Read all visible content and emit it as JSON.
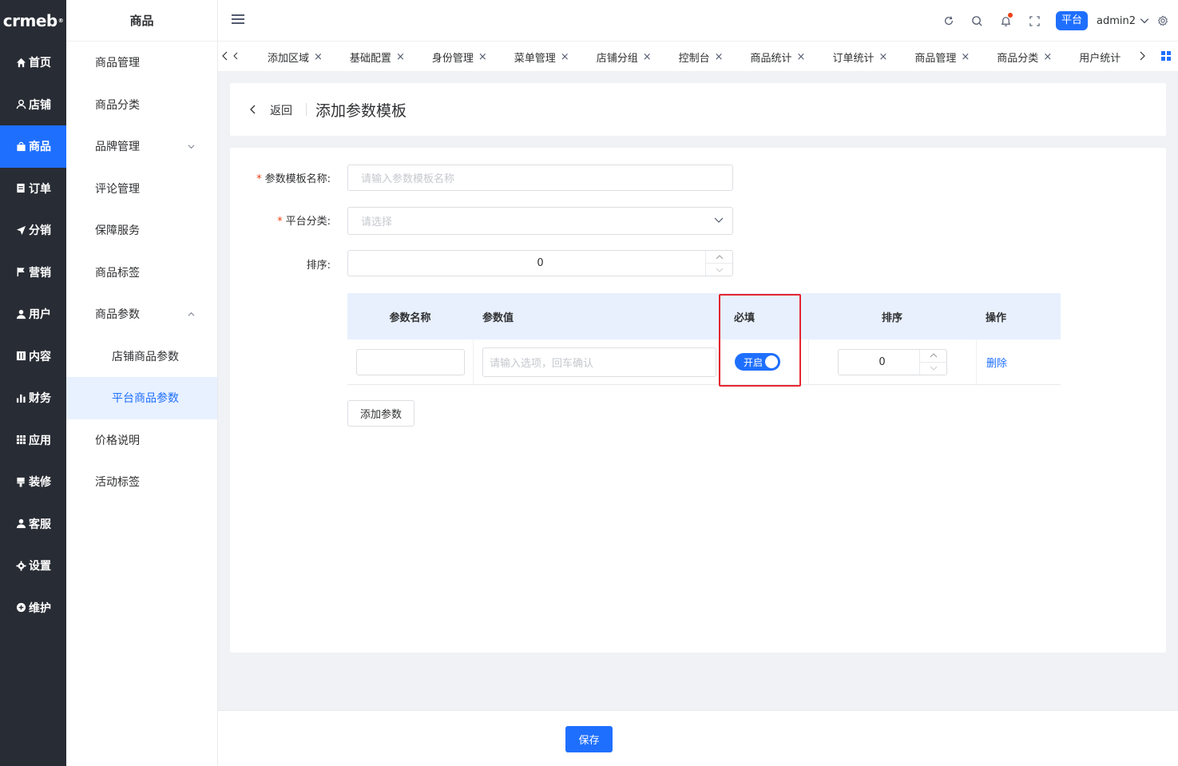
{
  "brand": {
    "name": "crmeb",
    "mark": "®"
  },
  "nav": {
    "items": [
      {
        "label": "首页",
        "icon": "home-icon"
      },
      {
        "label": "店铺",
        "icon": "shop-icon"
      },
      {
        "label": "商品",
        "icon": "goods-icon"
      },
      {
        "label": "订单",
        "icon": "order-icon"
      },
      {
        "label": "分销",
        "icon": "send-icon"
      },
      {
        "label": "营销",
        "icon": "flag-icon"
      },
      {
        "label": "用户",
        "icon": "user-icon"
      },
      {
        "label": "内容",
        "icon": "content-icon"
      },
      {
        "label": "财务",
        "icon": "bar-chart-icon"
      },
      {
        "label": "应用",
        "icon": "grid-icon"
      },
      {
        "label": "装修",
        "icon": "brush-icon"
      },
      {
        "label": "客服",
        "icon": "service-icon"
      },
      {
        "label": "设置",
        "icon": "gear-icon"
      },
      {
        "label": "维护",
        "icon": "plus-circle-icon"
      }
    ],
    "active_index": 2
  },
  "submenu": {
    "title": "商品",
    "items": [
      {
        "label": "商品管理"
      },
      {
        "label": "商品分类"
      },
      {
        "label": "品牌管理"
      },
      {
        "label": "评论管理"
      },
      {
        "label": "保障服务"
      },
      {
        "label": "商品标签"
      },
      {
        "label": "商品参数"
      },
      {
        "label": "店铺商品参数"
      },
      {
        "label": "平台商品参数"
      },
      {
        "label": "价格说明"
      },
      {
        "label": "活动标签"
      }
    ]
  },
  "header": {
    "icons": [
      "refresh-icon",
      "search-icon",
      "bell-icon",
      "fullscreen-icon"
    ],
    "platform_label": "平台",
    "username": "admin2"
  },
  "tabs": {
    "items": [
      {
        "label": "添加区域"
      },
      {
        "label": "基础配置"
      },
      {
        "label": "身份管理"
      },
      {
        "label": "菜单管理"
      },
      {
        "label": "店铺分组"
      },
      {
        "label": "控制台"
      },
      {
        "label": "商品统计"
      },
      {
        "label": "订单统计"
      },
      {
        "label": "商品管理"
      },
      {
        "label": "商品分类"
      },
      {
        "label": "用户统计"
      }
    ],
    "close_symbol": "×"
  },
  "page": {
    "back_label": "返回",
    "title": "添加参数模板"
  },
  "form": {
    "name_label": "参数模板名称:",
    "name_placeholder": "请输入参数模板名称",
    "category_label": "平台分类:",
    "category_placeholder": "请选择",
    "sort_label": "排序:",
    "sort_value": "0",
    "required_mark": "*"
  },
  "params_table": {
    "headers": {
      "name": "参数名称",
      "value": "参数值",
      "required": "必填",
      "sort": "排序",
      "action": "操作"
    },
    "rows": [
      {
        "name_value": "",
        "value_placeholder": "请输入选项，回车确认",
        "switch_label": "开启",
        "switch_on": true,
        "sort_value": "0",
        "action_label": "删除"
      }
    ],
    "add_button": "添加参数"
  },
  "footer": {
    "save_label": "保存"
  },
  "colors": {
    "primary": "#1f6fff",
    "nav_bg": "#282c34",
    "highlight": "#e5262f"
  }
}
